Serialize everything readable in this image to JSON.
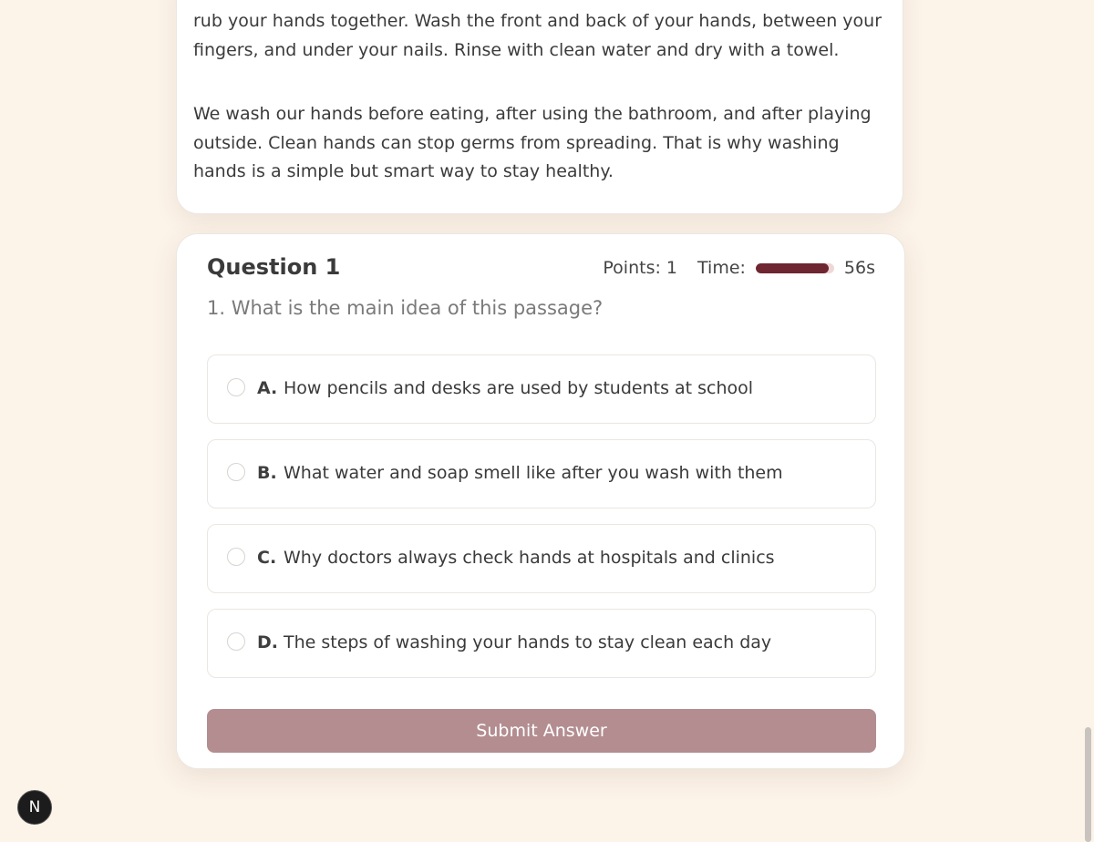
{
  "passage": {
    "paragraphs": [
      "rub your hands together. Wash the front and back of your hands, between your fingers, and under your nails. Rinse with clean water and dry with a towel.",
      "We wash our hands before eating, after using the bathroom, and after playing outside. Clean hands can stop germs from spreading. That is why washing hands is a simple but smart way to stay healthy."
    ]
  },
  "question": {
    "title": "Question 1",
    "points_label": "Points: 1",
    "time_label": "Time:",
    "time_remaining": "56s",
    "timer_fraction": 0.93,
    "text": "1. What is the main idea of this passage?",
    "options": [
      {
        "letter": "A.",
        "text": "How pencils and desks are used by students at school"
      },
      {
        "letter": "B.",
        "text": "What water and soap smell like after you wash with them"
      },
      {
        "letter": "C.",
        "text": "Why doctors always check hands at hospitals and clinics"
      },
      {
        "letter": "D.",
        "text": "The steps of washing your hands to stay clean each day"
      }
    ],
    "submit_label": "Submit Answer"
  },
  "badge": {
    "letter": "N"
  },
  "colors": {
    "background": "#fcf3e9",
    "timer_fill": "#6e2630",
    "submit_bg": "#b38d90"
  }
}
